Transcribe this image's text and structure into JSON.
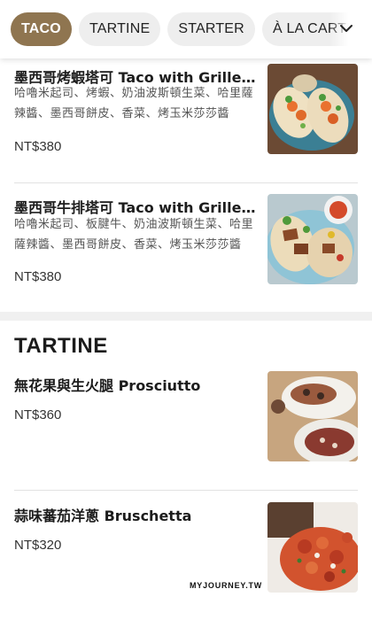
{
  "tabs": [
    {
      "label": "TACO",
      "active": true
    },
    {
      "label": "TARTINE",
      "active": false
    },
    {
      "label": "STARTER",
      "active": false
    },
    {
      "label": "À LA CARTE",
      "active": false
    }
  ],
  "taco_items": [
    {
      "name": "墨西哥烤蝦塔可 Taco with Grilled Shrimp",
      "description": "哈嚕米起司、烤蝦、奶油波斯頓生菜、哈里薩辣醬、墨西哥餅皮、香菜、烤玉米莎莎醬",
      "price": "NT$380",
      "image_icon": "shrimp-taco-photo"
    },
    {
      "name": "墨西哥牛排塔可 Taco with Grilled Steak",
      "description": "哈嚕米起司、板腱牛、奶油波斯頓生菜、哈里薩辣醬、墨西哥餅皮、香菜、烤玉米莎莎醬",
      "price": "NT$380",
      "image_icon": "steak-taco-photo"
    }
  ],
  "tartine_section": {
    "title": "TARTINE",
    "items": [
      {
        "name": "無花果與生火腿 Prosciutto",
        "price": "NT$360",
        "image_icon": "prosciutto-tartine-photo"
      },
      {
        "name": "蒜味蕃茄洋蔥 Bruschetta",
        "price": "NT$320",
        "image_icon": "bruschetta-photo"
      }
    ]
  },
  "watermark": "MYJOURNEY.TW",
  "colors": {
    "accent": "#8f7550",
    "tab_bg": "#eeeeee",
    "divider": "#e2e2e2"
  }
}
